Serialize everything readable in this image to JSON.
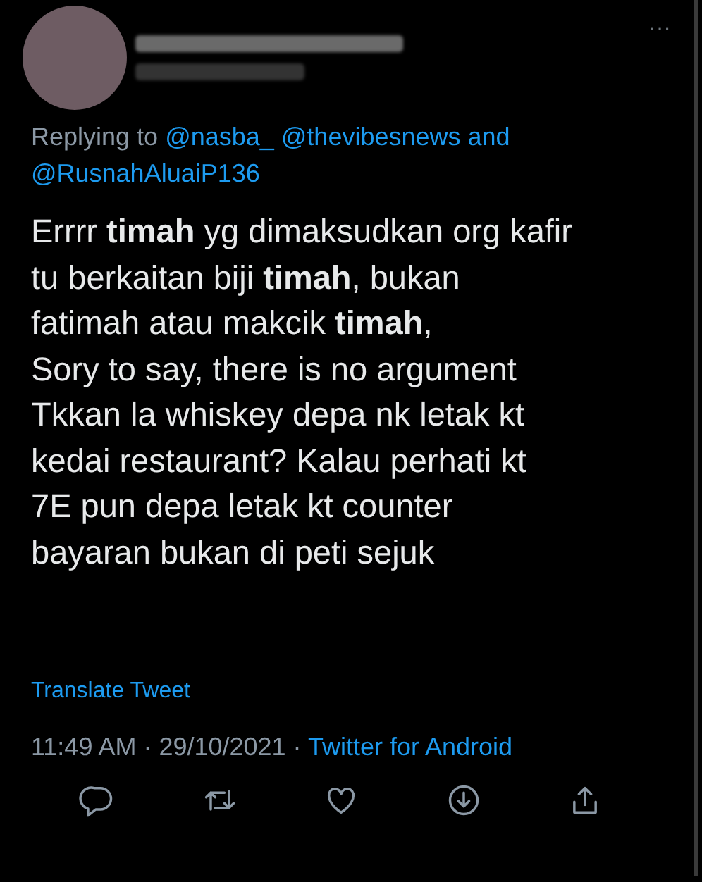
{
  "tweet": {
    "more_button": "···",
    "replying": {
      "label": "Replying to",
      "mentions": [
        "@nasba_",
        "@thevibesnews"
      ],
      "joiner": "and",
      "last_mention": "@RusnahAluaiP136"
    },
    "body": "Errrr **timah** yg dimaksudkan org kafir\ntu berkaitan biji **timah**, bukan\nfatimah atau makcik **timah**,\nSory to say, there is no argument\nTkkan la whiskey depa nk letak kt\nkedai restaurant? Kalau perhati kt\n7E pun depa letak kt counter\nbayaran bukan di peti sejuk",
    "translate": "Translate Tweet",
    "separator": "·",
    "time": "11:49 AM",
    "date": "29/10/2021",
    "source": "Twitter for Android",
    "actions": [
      {
        "kind": "reply"
      },
      {
        "kind": "retweet"
      },
      {
        "kind": "like"
      },
      {
        "kind": "download"
      },
      {
        "kind": "share"
      }
    ]
  }
}
